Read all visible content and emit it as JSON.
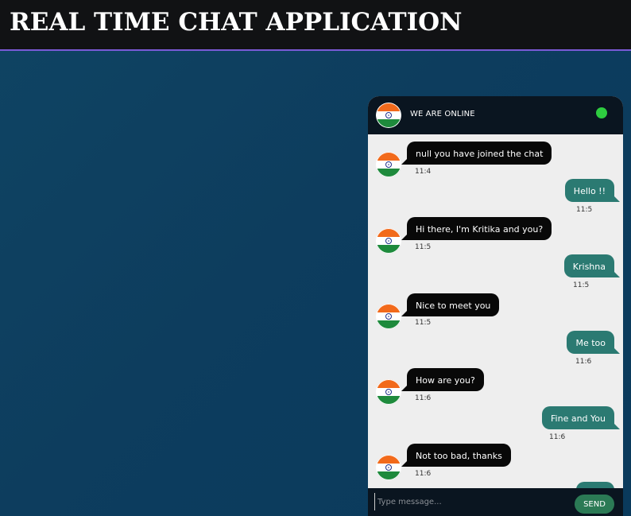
{
  "app": {
    "title": "REAL TIME CHAT APPLICATION"
  },
  "chat": {
    "header_title": "WE ARE ONLINE",
    "online_color": "#2ecc40",
    "avatar_icon": "india-flag-icon",
    "messages": [
      {
        "side": "in",
        "text": "null you have joined the chat",
        "time": "11:4"
      },
      {
        "side": "out",
        "text": "Hello !!",
        "time": "11:5"
      },
      {
        "side": "in",
        "text": "Hi there, I'm Kritika and you?",
        "time": "11:5"
      },
      {
        "side": "out",
        "text": "Krishna",
        "time": "11:5"
      },
      {
        "side": "in",
        "text": "Nice to meet you",
        "time": "11:5"
      },
      {
        "side": "out",
        "text": "Me too",
        "time": "11:6"
      },
      {
        "side": "in",
        "text": "How are you?",
        "time": "11:6"
      },
      {
        "side": "out",
        "text": "Fine and You",
        "time": "11:6"
      },
      {
        "side": "in",
        "text": "Not too bad, thanks",
        "time": "11:6"
      }
    ],
    "input_placeholder": "Type message...",
    "send_label": "SEND"
  },
  "colors": {
    "incoming_bubble": "#080808",
    "outgoing_bubble": "#2b7a72",
    "header_bg": "#0a1520",
    "topbar_border": "#7a5ad6"
  }
}
